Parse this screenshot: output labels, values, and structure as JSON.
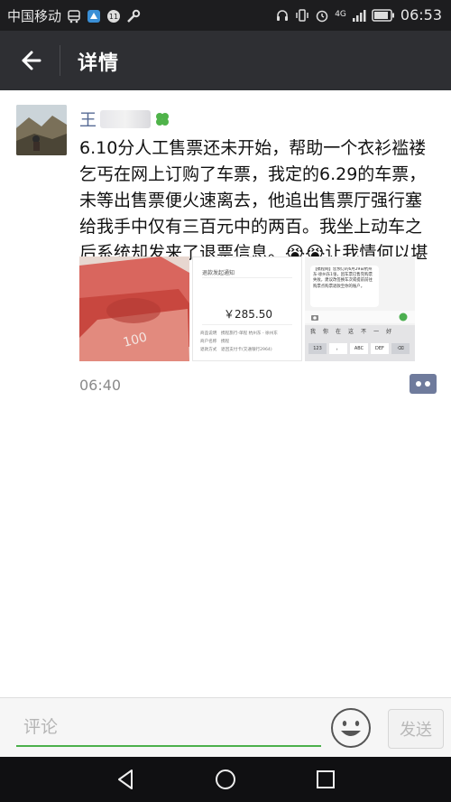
{
  "status_bar": {
    "carrier": "中国移动",
    "network": "4G",
    "time": "06:53"
  },
  "header": {
    "title": "详情",
    "back_icon": "back-arrow-icon"
  },
  "post": {
    "author": "王",
    "text": "6.10分人工售票还未开始，帮助一个衣衫褴褛乞丐在网上订购了车票，我定的6.29的车票，未等出售票便火速离去，他追出售票厅强行塞给我手中仅有三百元中的两百。我坐上动车之后系统却发来了退票信息。😭😭让我情何以堪",
    "time": "06:40",
    "images": [
      {
        "type": "cash-photo"
      },
      {
        "type": "refund-screenshot",
        "heading": "退款发起通知",
        "amount": "￥285.50",
        "rows": [
          {
            "label": "商品说明",
            "value": "携程旅行-单程 杭州东 - 徐州东"
          },
          {
            "label": "商户名称",
            "value": "携程"
          },
          {
            "label": "退款方式",
            "value": "退回支付卡(交通银行2964)"
          }
        ]
      },
      {
        "type": "sms-screenshot",
        "sms_text": "【携程网】您预订的6月29日杭州东-徐州东1张，因车票已售完购票失败，建议改签换车次或提前前往购票点购票退款至你的账户。",
        "keyboard": {
          "suggestions": [
            "我",
            "你",
            "在",
            "这",
            "不",
            "一",
            "好"
          ],
          "keys": [
            "123",
            "，",
            "ABC",
            "DEF"
          ]
        }
      }
    ]
  },
  "comment_bar": {
    "placeholder": "评论",
    "send_label": "发送"
  }
}
